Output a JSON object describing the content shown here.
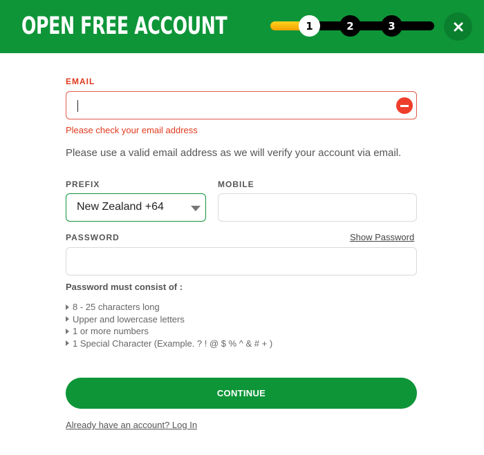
{
  "header": {
    "title": "OPEN FREE ACCOUNT",
    "steps": [
      "1",
      "2",
      "3"
    ],
    "active_step": 1,
    "progress_fraction": 0.21,
    "close_icon": "close-icon"
  },
  "form": {
    "email": {
      "label": "EMAIL",
      "value": "",
      "error": "Please check your email address",
      "error_icon": "minus-circle-icon"
    },
    "help_text": "Please use a valid email address as we will verify your account via email.",
    "prefix": {
      "label": "PREFIX",
      "value": "New Zealand +64"
    },
    "mobile": {
      "label": "MOBILE",
      "value": ""
    },
    "password": {
      "label": "PASSWORD",
      "value": "",
      "show_label": "Show Password"
    },
    "rules_title": "Password must consist of :",
    "rules": [
      "8 - 25 characters long",
      "Upper and lowercase letters",
      "1 or more numbers",
      "1 Special Character (Example. ? ! @ $ % ^ & # + )"
    ],
    "continue_label": "CONTINUE",
    "login_link": "Already have an account? Log In"
  },
  "colors": {
    "brand_green": "#0e9538",
    "error_red": "#e03a1e",
    "progress_yellow": "#ffd21f"
  }
}
